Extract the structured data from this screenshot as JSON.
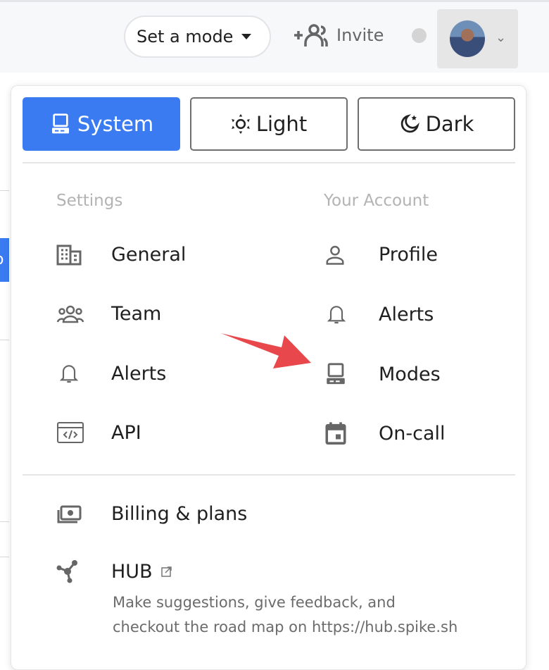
{
  "topbar": {
    "mode_label": "Set a mode",
    "invite_label": "Invite"
  },
  "edge": {
    "partial_text": "o"
  },
  "modes": [
    {
      "label": "System",
      "icon": "computer-icon",
      "active": true
    },
    {
      "label": "Light",
      "icon": "sun-icon",
      "active": false
    },
    {
      "label": "Dark",
      "icon": "moon-stars-icon",
      "active": false
    }
  ],
  "settings": {
    "heading": "Settings",
    "items": [
      {
        "label": "General",
        "icon": "building-icon"
      },
      {
        "label": "Team",
        "icon": "team-icon"
      },
      {
        "label": "Alerts",
        "icon": "bell-icon"
      },
      {
        "label": "API",
        "icon": "code-window-icon"
      }
    ]
  },
  "account": {
    "heading": "Your Account",
    "items": [
      {
        "label": "Profile",
        "icon": "person-icon"
      },
      {
        "label": "Alerts",
        "icon": "bell-icon"
      },
      {
        "label": "Modes",
        "icon": "computer-icon"
      },
      {
        "label": "On-call",
        "icon": "calendar-icon"
      }
    ]
  },
  "billing": {
    "label": "Billing & plans",
    "icon": "money-icon"
  },
  "hub": {
    "label": "HUB",
    "icon": "network-icon",
    "description_line1": "Make suggestions, give feedback, and",
    "description_line2": "checkout the road map on https://hub.spike.sh"
  },
  "colors": {
    "accent": "#3a7bf2",
    "annotation_arrow": "#e8474c"
  }
}
